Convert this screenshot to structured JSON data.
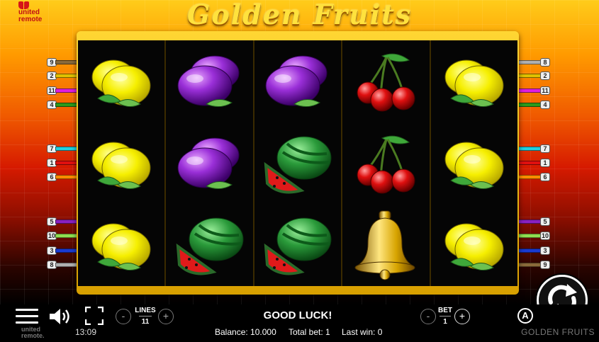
{
  "brand": {
    "name_line1": "united",
    "name_line2": "remote"
  },
  "title": "Golden Fruits",
  "reels": [
    [
      "lemon",
      "lemon",
      "lemon"
    ],
    [
      "plum",
      "plum",
      "watermelon"
    ],
    [
      "plum",
      "watermelon",
      "watermelon"
    ],
    [
      "cherry",
      "cherry",
      "bell"
    ],
    [
      "lemon",
      "lemon",
      "lemon"
    ]
  ],
  "paylines_left": [
    {
      "num": "9",
      "color": "#8a6a3a"
    },
    {
      "num": "2",
      "color": "#e0c000"
    },
    {
      "num": "11",
      "color": "#e01ee0"
    },
    {
      "num": "4",
      "color": "#2a9a1a"
    },
    {
      "num": "7",
      "color": "#20d0e0"
    },
    {
      "num": "1",
      "color": "#e01010"
    },
    {
      "num": "6",
      "color": "#ff8c00"
    },
    {
      "num": "5",
      "color": "#8a20c0"
    },
    {
      "num": "10",
      "color": "#90e050"
    },
    {
      "num": "3",
      "color": "#1a3ad0"
    },
    {
      "num": "8",
      "color": "#b0b0b0"
    }
  ],
  "paylines_right": [
    {
      "num": "8",
      "color": "#b0b0b0"
    },
    {
      "num": "2",
      "color": "#e0c000"
    },
    {
      "num": "11",
      "color": "#e01ee0"
    },
    {
      "num": "4",
      "color": "#2a9a1a"
    },
    {
      "num": "7",
      "color": "#20d0e0"
    },
    {
      "num": "1",
      "color": "#e01010"
    },
    {
      "num": "6",
      "color": "#ff8c00"
    },
    {
      "num": "5",
      "color": "#8a20c0"
    },
    {
      "num": "10",
      "color": "#90e050"
    },
    {
      "num": "3",
      "color": "#1a3ad0"
    },
    {
      "num": "9",
      "color": "#8a6a3a"
    }
  ],
  "controls": {
    "lines_label": "LINES",
    "lines_value": "11",
    "minus": "-",
    "plus": "+",
    "message": "GOOD LUCK!",
    "bet_label": "BET",
    "bet_value": "1",
    "auto_label": "A"
  },
  "status": {
    "time": "13:09",
    "balance": "Balance: 10.000",
    "total_bet": "Total bet: 1",
    "last_win": "Last win: 0",
    "footer_brand_line1": "united",
    "footer_brand_line2": "remote.",
    "game_name": "GOLDEN FRUITS"
  },
  "colors": {
    "frame_gold": "#ffd633",
    "title_gold": "#ffe23d",
    "brand_red": "#d61518"
  }
}
